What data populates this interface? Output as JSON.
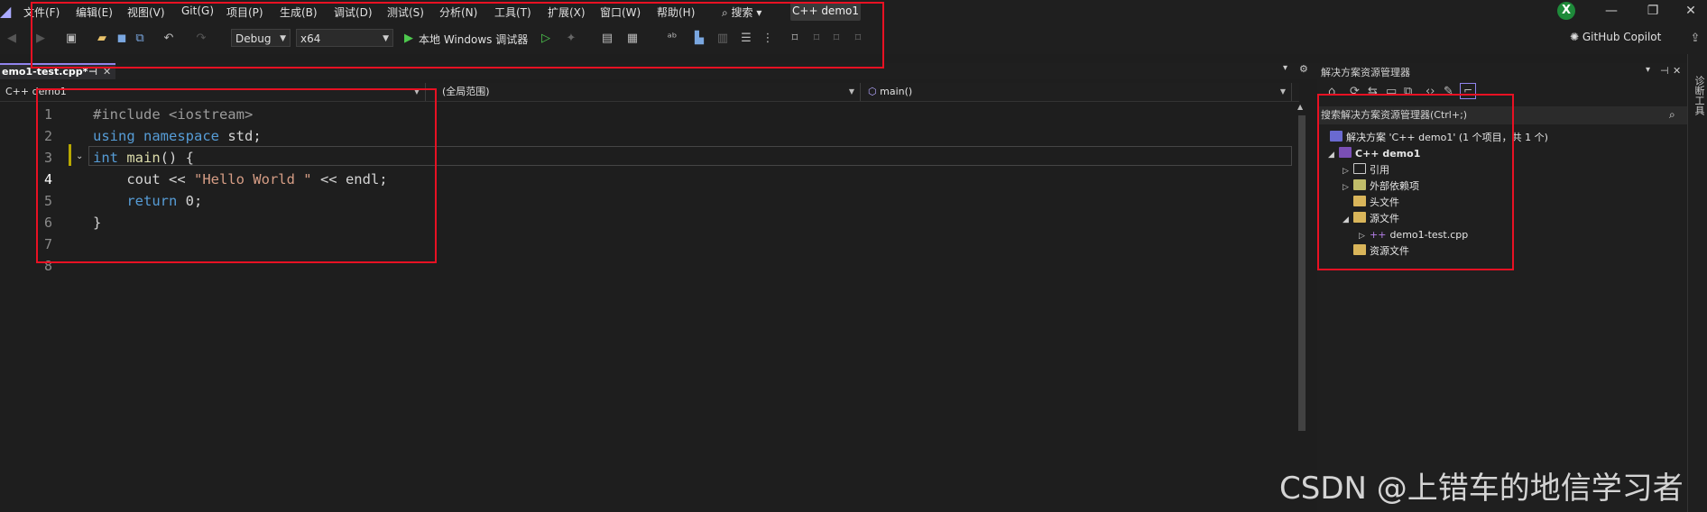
{
  "menubar": {
    "items": [
      "文件(F)",
      "编辑(E)",
      "视图(V)",
      "Git(G)",
      "项目(P)",
      "生成(B)",
      "调试(D)",
      "测试(S)",
      "分析(N)",
      "工具(T)",
      "扩展(X)",
      "窗口(W)",
      "帮助(H)"
    ],
    "search_label": "⌕ 搜索 ▾",
    "solution_name": "C++ demo1",
    "avatar_letter": "X"
  },
  "toolbar": {
    "config": "Debug",
    "platform": "x64",
    "run_label": "本地 Windows 调试器",
    "copilot_label": "GitHub Copilot"
  },
  "tab": {
    "label": "emo1-test.cpp*",
    "pin": "⊣",
    "close": "✕"
  },
  "navbar": {
    "project": "C++ demo1",
    "scope": "(全局范围)",
    "member": "main()"
  },
  "editor": {
    "line_numbers": [
      "1",
      "2",
      "3",
      "4",
      "5",
      "6",
      "7",
      "8"
    ],
    "current_line": 4
  },
  "solution_explorer": {
    "title": "解决方案资源管理器",
    "search_placeholder": "搜索解决方案资源管理器(Ctrl+;)",
    "solution_label": "解决方案 'C++ demo1' (1 个项目，共 1 个)",
    "project_label": "C++ demo1",
    "items": [
      "引用",
      "外部依赖项",
      "头文件",
      "源文件",
      "demo1-test.cpp",
      "资源文件"
    ]
  },
  "side_strip": {
    "label": "诊断工具"
  },
  "watermark": "CSDN @上错车的地信学习者",
  "colors": {
    "accent": "#9184ee",
    "annotation_red": "#e81123",
    "background": "#1e1e1e"
  }
}
